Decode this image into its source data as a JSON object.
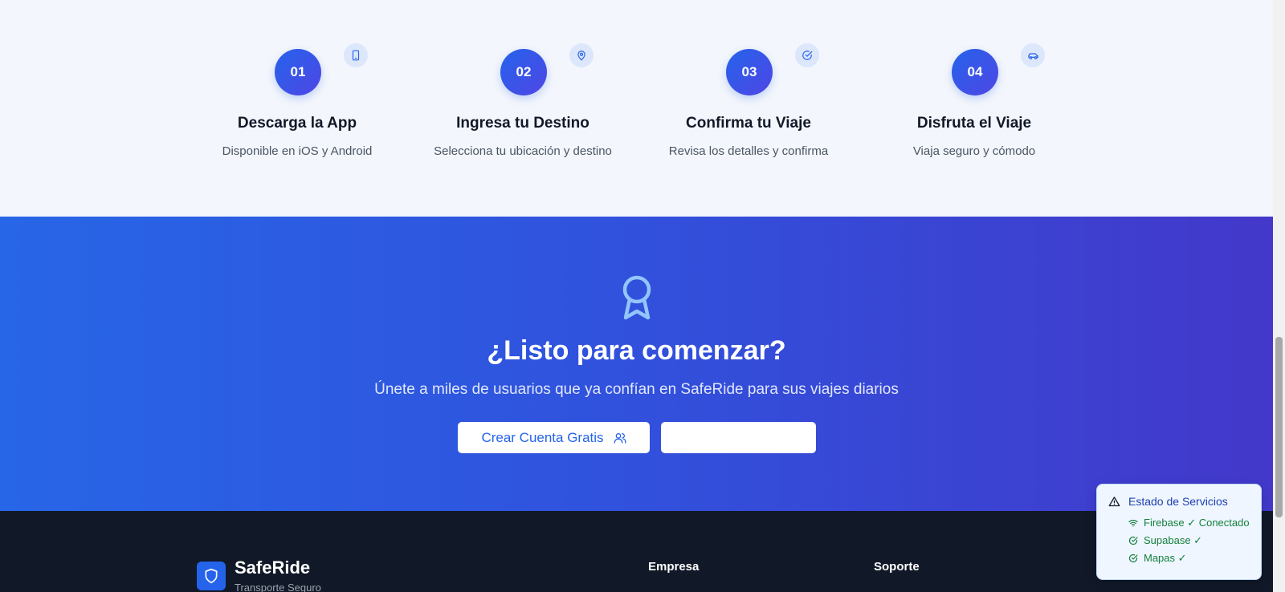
{
  "steps": [
    {
      "number": "01",
      "title": "Descarga la App",
      "description": "Disponible en iOS y Android",
      "icon": "smartphone-icon"
    },
    {
      "number": "02",
      "title": "Ingresa tu Destino",
      "description": "Selecciona tu ubicación y destino",
      "icon": "map-pin-icon"
    },
    {
      "number": "03",
      "title": "Confirma tu Viaje",
      "description": "Revisa los detalles y confirma",
      "icon": "check-circle-icon"
    },
    {
      "number": "04",
      "title": "Disfruta el Viaje",
      "description": "Viaja seguro y cómodo",
      "icon": "car-icon"
    }
  ],
  "cta": {
    "icon": "award-icon",
    "headline": "¿Listo para comenzar?",
    "subtitle": "Únete a miles de usuarios que ya confían en SafeRide para sus viajes diarios",
    "primary_button": "Crear Cuenta Gratis",
    "primary_button_icon": "users-icon",
    "secondary_button": ""
  },
  "footer": {
    "brand_name": "SafeRide",
    "brand_tagline": "Transporte Seguro",
    "columns": [
      "Empresa",
      "Soporte"
    ]
  },
  "status_panel": {
    "title": "Estado de Servicios",
    "items": [
      {
        "label": "Firebase ✓ Conectado",
        "icon": "wifi-icon"
      },
      {
        "label": "Supabase ✓",
        "icon": "check-circle-icon"
      },
      {
        "label": "Mapas ✓",
        "icon": "check-circle-icon"
      }
    ]
  },
  "colors": {
    "primary": "#2563eb",
    "accent": "#4f46e5",
    "footer_bg": "#111827",
    "status_green": "#15803d"
  }
}
